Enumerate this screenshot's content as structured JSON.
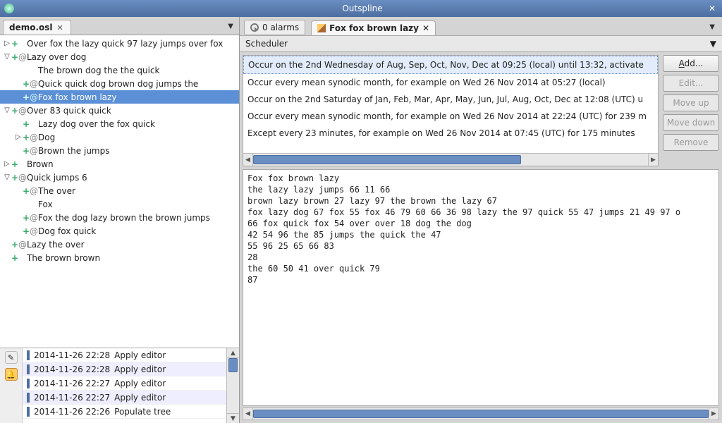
{
  "app": {
    "title": "Outspline"
  },
  "left_tab": {
    "label": "demo.osl"
  },
  "tree": [
    {
      "indent": 0,
      "tw": "▷",
      "plus": true,
      "at": false,
      "text": "Over fox the lazy quick 97 lazy jumps over fox",
      "sel": false
    },
    {
      "indent": 0,
      "tw": "▽",
      "plus": true,
      "at": true,
      "text": "Lazy over dog",
      "sel": false
    },
    {
      "indent": 1,
      "tw": "",
      "plus": false,
      "at": false,
      "text": "The brown dog the the quick",
      "sel": false
    },
    {
      "indent": 1,
      "tw": "",
      "plus": true,
      "at": true,
      "text": "Quick quick dog brown dog jumps the",
      "sel": false
    },
    {
      "indent": 1,
      "tw": "",
      "plus": true,
      "at": true,
      "text": "Fox fox brown lazy",
      "sel": true
    },
    {
      "indent": 0,
      "tw": "▽",
      "plus": true,
      "at": true,
      "text": "Over 83 quick quick",
      "sel": false
    },
    {
      "indent": 1,
      "tw": "",
      "plus": true,
      "at": false,
      "text": "Lazy dog over the fox quick",
      "sel": false
    },
    {
      "indent": 1,
      "tw": "▷",
      "plus": true,
      "at": true,
      "text": "Dog",
      "sel": false
    },
    {
      "indent": 1,
      "tw": "",
      "plus": true,
      "at": true,
      "text": "Brown the jumps",
      "sel": false
    },
    {
      "indent": 0,
      "tw": "▷",
      "plus": true,
      "at": false,
      "text": "Brown",
      "sel": false
    },
    {
      "indent": 0,
      "tw": "▽",
      "plus": true,
      "at": true,
      "text": "Quick jumps 6",
      "sel": false
    },
    {
      "indent": 1,
      "tw": "",
      "plus": true,
      "at": true,
      "text": "The over",
      "sel": false
    },
    {
      "indent": 1,
      "tw": "",
      "plus": false,
      "at": false,
      "text": "Fox",
      "sel": false
    },
    {
      "indent": 1,
      "tw": "",
      "plus": true,
      "at": true,
      "text": "Fox the dog lazy brown the brown jumps",
      "sel": false
    },
    {
      "indent": 1,
      "tw": "",
      "plus": true,
      "at": true,
      "text": "Dog fox quick",
      "sel": false
    },
    {
      "indent": 0,
      "tw": "",
      "plus": true,
      "at": true,
      "text": "Lazy the over",
      "sel": false
    },
    {
      "indent": 0,
      "tw": "",
      "plus": true,
      "at": false,
      "text": "The brown brown",
      "sel": false
    }
  ],
  "history": [
    {
      "time": "2014-11-26 22:28",
      "action": "Apply editor",
      "alt": false
    },
    {
      "time": "2014-11-26 22:28",
      "action": "Apply editor",
      "alt": true
    },
    {
      "time": "2014-11-26 22:27",
      "action": "Apply editor",
      "alt": false
    },
    {
      "time": "2014-11-26 22:27",
      "action": "Apply editor",
      "alt": true
    },
    {
      "time": "2014-11-26 22:26",
      "action": "Populate tree",
      "alt": false
    }
  ],
  "alarms": {
    "text": "0 alarms"
  },
  "right_tab": {
    "label": "Fox fox brown lazy"
  },
  "scheduler": {
    "title": "Scheduler"
  },
  "rules": [
    {
      "text": "Occur on the 2nd Wednesday of Aug, Sep, Oct, Nov, Dec at 09:25 (local) until 13:32, activate",
      "sel": true
    },
    {
      "text": "Occur every mean synodic month, for example on Wed 26 Nov 2014 at 05:27 (local)",
      "sel": false
    },
    {
      "text": "Occur on the 2nd Saturday of Jan, Feb, Mar, Apr, May, Jun, Jul, Aug, Oct, Dec at 12:08 (UTC) u",
      "sel": false
    },
    {
      "text": "Occur every mean synodic month, for example on Wed 26 Nov 2014 at 22:24 (UTC) for 239 m",
      "sel": false
    },
    {
      "text": "Except every 23 minutes, for example on Wed 26 Nov 2014 at 07:45 (UTC) for 175 minutes",
      "sel": false
    }
  ],
  "buttons": {
    "add": "Add...",
    "edit": "Edit...",
    "moveup": "Move up",
    "movedown": "Move down",
    "remove": "Remove"
  },
  "editor_text": "Fox fox brown lazy\nthe lazy lazy jumps 66 11 66\nbrown lazy brown 27 lazy 97 the brown the lazy 67\nfox lazy dog 67 fox 55 fox 46 79 60 66 36 98 lazy the 97 quick 55 47 jumps 21 49 97 o\n66 fox quick fox 54 over over 18 dog the dog\n42 54 96 the 85 jumps the quick the 47\n55 96 25 65 66 83\n28\nthe 60 50 41 over quick 79\n87"
}
